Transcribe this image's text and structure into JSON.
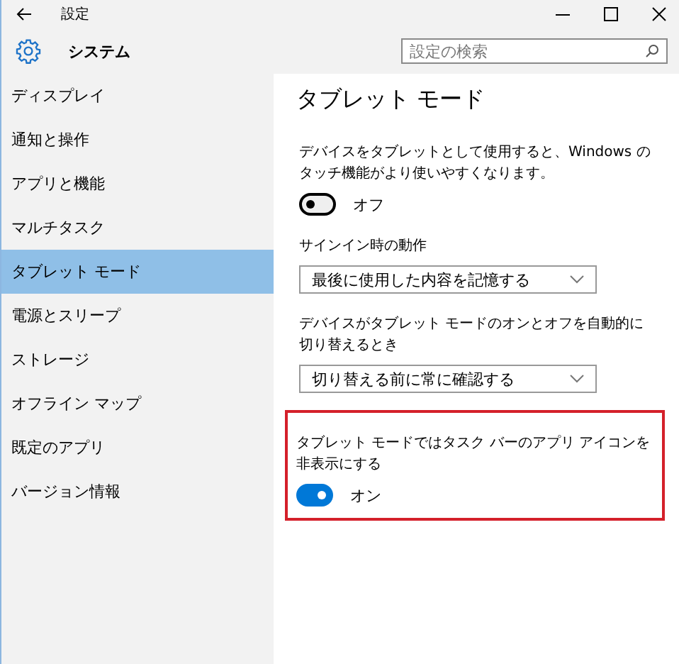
{
  "window": {
    "title": "設定"
  },
  "header": {
    "title": "システム",
    "search": {
      "placeholder": "設定の検索"
    }
  },
  "sidebar": {
    "items": [
      {
        "label": "ディスプレイ",
        "selected": false
      },
      {
        "label": "通知と操作",
        "selected": false
      },
      {
        "label": "アプリと機能",
        "selected": false
      },
      {
        "label": "マルチタスク",
        "selected": false
      },
      {
        "label": "タブレット モード",
        "selected": true
      },
      {
        "label": "電源とスリープ",
        "selected": false
      },
      {
        "label": "ストレージ",
        "selected": false
      },
      {
        "label": "オフライン マップ",
        "selected": false
      },
      {
        "label": "既定のアプリ",
        "selected": false
      },
      {
        "label": "バージョン情報",
        "selected": false
      }
    ]
  },
  "content": {
    "title": "タブレット モード",
    "groups": [
      {
        "kind": "toggle",
        "text": "デバイスをタブレットとして使用すると、Windows のタッチ機能がより使いやすくなります。",
        "on": false,
        "state_label": "オフ",
        "highlighted": false
      },
      {
        "kind": "dropdown",
        "text": "サインイン時の動作",
        "value": "最後に使用した内容を記憶する",
        "highlighted": false
      },
      {
        "kind": "dropdown",
        "text": "デバイスがタブレット モードのオンとオフを自動的に切り替えるとき",
        "value": "切り替える前に常に確認する",
        "highlighted": false
      },
      {
        "kind": "toggle",
        "text": "タブレット モードではタスク バーのアプリ アイコンを非表示にする",
        "on": true,
        "state_label": "オン",
        "highlighted": true
      }
    ]
  }
}
